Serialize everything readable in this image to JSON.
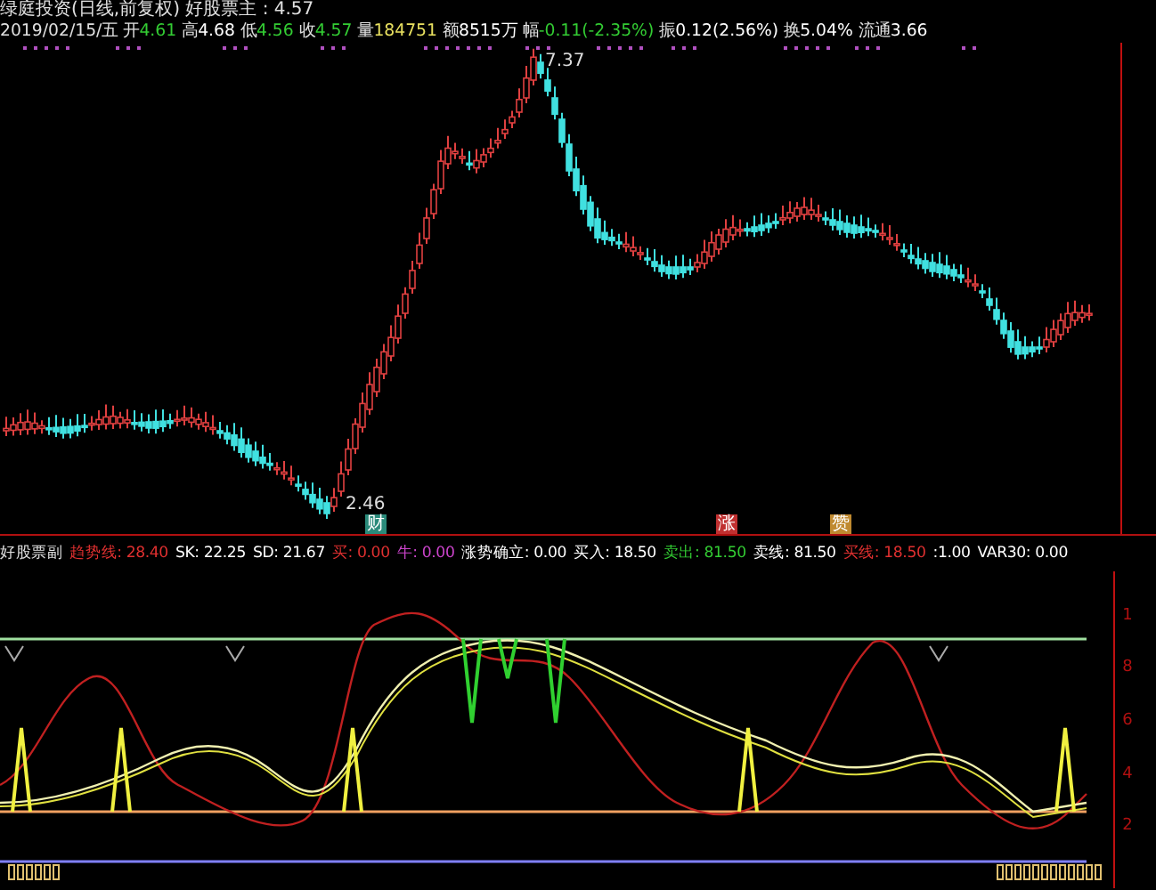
{
  "title": {
    "text": "绿庭投资(日线,前复权) 好股票主 : 4.57"
  },
  "quote": [
    {
      "label": "2019/02/15/五"
    },
    {
      "label": "开",
      "value": "4.61",
      "color": "#33cc33"
    },
    {
      "label": "高",
      "value": "4.68",
      "color": "#ffffff"
    },
    {
      "label": "低",
      "value": "4.56",
      "color": "#33cc33"
    },
    {
      "label": "收",
      "value": "4.57",
      "color": "#33cc33"
    },
    {
      "label": "量",
      "value": "184751",
      "color": "#e8e060"
    },
    {
      "label": "额",
      "value": "8515万",
      "color": "#ffffff"
    },
    {
      "label": "幅",
      "value": "-0.11(-2.35%)",
      "color": "#33cc33"
    },
    {
      "label": "振",
      "value": "0.12(2.56%)",
      "color": "#ffffff"
    },
    {
      "label": "换",
      "value": "5.04%",
      "color": "#ffffff"
    },
    {
      "label": "流通",
      "value": "3.66",
      "color": "#ffffff"
    }
  ],
  "main_chart": {
    "high_label": "7.37",
    "low_label": "2.46",
    "markers": [
      {
        "text": "财",
        "color": "#2a8a7a"
      },
      {
        "text": "涨",
        "color": "#c03030"
      },
      {
        "text": "赞",
        "color": "#c08a30"
      }
    ]
  },
  "indicator": {
    "name": "好股票副",
    "values": [
      {
        "label": "趋势线:",
        "value": "28.40",
        "color": "#e03030"
      },
      {
        "label": "SK:",
        "value": "22.25",
        "color": "#ffffff"
      },
      {
        "label": "SD:",
        "value": "21.67",
        "color": "#ffffff"
      },
      {
        "label": "买:",
        "value": "0.00",
        "color": "#e03030"
      },
      {
        "label": "牛:",
        "value": "0.00",
        "color": "#cc44cc"
      },
      {
        "label": "涨势确立:",
        "value": "0.00",
        "color": "#ffffff"
      },
      {
        "label": "买入:",
        "value": "18.50",
        "color": "#ffffff"
      },
      {
        "label": "卖出:",
        "value": "81.50",
        "color": "#33cc33"
      },
      {
        "label": "卖线:",
        "value": "81.50",
        "color": "#ffffff"
      },
      {
        "label": "买线:",
        "value": "18.50",
        "color": "#e03030"
      },
      {
        "value": ":1.00",
        "color": "#ffffff"
      },
      {
        "label": "VAR30:",
        "value": "0.00",
        "color": "#ffffff"
      }
    ],
    "axis_labels": [
      "1",
      "8",
      "6",
      "4",
      "2"
    ]
  }
}
